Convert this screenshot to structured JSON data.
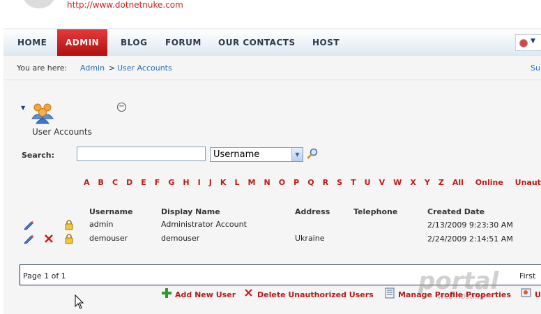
{
  "site": {
    "url": "http://www.dotnetnuke.com"
  },
  "nav": {
    "items": [
      "HOME",
      "ADMIN",
      "BLOG",
      "FORUM",
      "OUR CONTACTS",
      "HOST"
    ],
    "active": "ADMIN",
    "accent": "#cc1f1f"
  },
  "breadcrumb": {
    "label": "You are here:",
    "items": [
      "Admin",
      "User Accounts"
    ],
    "separator": ">",
    "right_link": "Su"
  },
  "module": {
    "title": "User Accounts",
    "icon": "users-icon"
  },
  "search": {
    "label": "Search:",
    "value": "",
    "field_selected": "Username"
  },
  "letters": [
    "A",
    "B",
    "C",
    "D",
    "E",
    "F",
    "G",
    "H",
    "I",
    "J",
    "K",
    "L",
    "M",
    "N",
    "O",
    "P",
    "Q",
    "R",
    "S",
    "T",
    "U",
    "V",
    "W",
    "X",
    "Y",
    "Z",
    "All",
    "Online",
    "Unauth"
  ],
  "table": {
    "headers": [
      "Username",
      "Display Name",
      "Address",
      "Telephone",
      "Created Date"
    ],
    "rows": [
      {
        "username": "admin",
        "display_name": "Administrator Account",
        "address": "",
        "telephone": "",
        "created": "2/13/2009 9:23:30 AM",
        "deletable": false
      },
      {
        "username": "demouser",
        "display_name": "demouser",
        "address": "Ukraine",
        "telephone": "",
        "created": "2/24/2009 2:14:51 AM",
        "deletable": true
      }
    ]
  },
  "pager": {
    "text": "Page 1 of 1",
    "first": "First"
  },
  "actions": [
    "Add New User",
    "Delete Unauthorized Users",
    "Manage Profile Properties",
    "U"
  ],
  "watermark": {
    "line1": "portal",
    "line2": "web hosting"
  }
}
